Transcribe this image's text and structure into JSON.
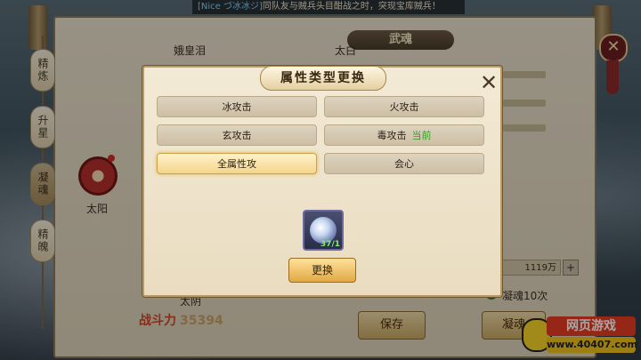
{
  "marquee": {
    "player": "[Nice づ冰冰ジ]",
    "text": "同队友与贼兵头目酣战之时，突现宝库贼兵！"
  },
  "panel": {
    "title": "武魂"
  },
  "side_tabs": [
    "精炼",
    "升星",
    "凝魂",
    "精魄"
  ],
  "background": {
    "name_top": "娥皇泪",
    "name_right": "太白",
    "orb_label": "太阳",
    "name_bottom": "太阴",
    "power_label": "战斗力",
    "power_value": "35394",
    "money": "1119万",
    "plus": "+",
    "check": "✓",
    "soul_count": "凝魂10次",
    "save_button": "保存",
    "soul_button": "凝魂"
  },
  "modal": {
    "title": "属性类型更换",
    "close": "✕",
    "options": [
      {
        "label": "冰攻击",
        "current": ""
      },
      {
        "label": "火攻击",
        "current": ""
      },
      {
        "label": "玄攻击",
        "current": ""
      },
      {
        "label": "毒攻击",
        "current": "当前"
      },
      {
        "label": "全属性攻",
        "current": ""
      },
      {
        "label": "会心",
        "current": ""
      }
    ],
    "selected_index": 4,
    "item_count": "37/1",
    "confirm_button": "更换"
  },
  "logo": {
    "top": "网页游戏",
    "bottom": "www.40407.com"
  }
}
